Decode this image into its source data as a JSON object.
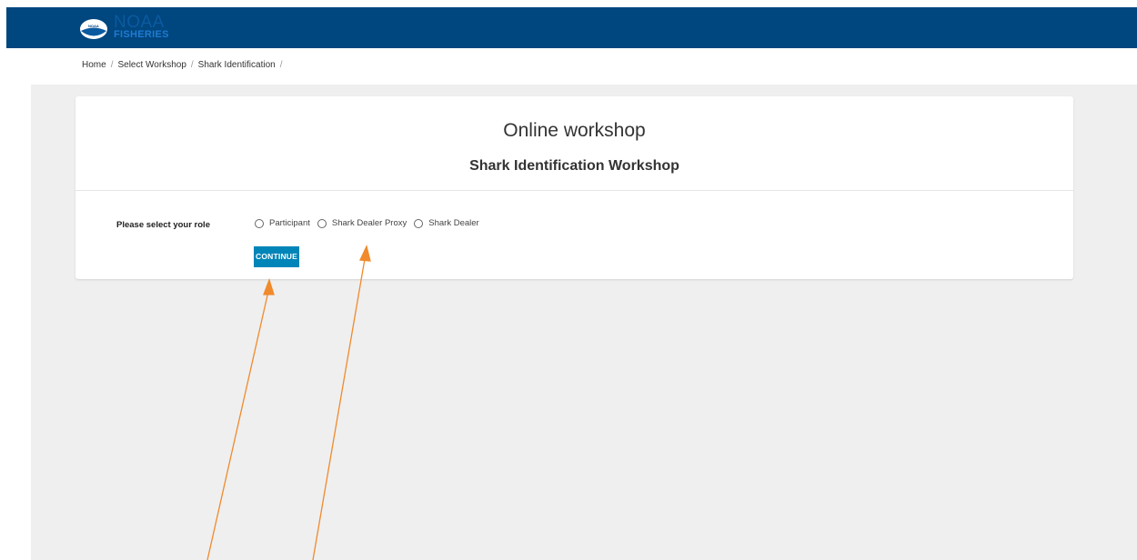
{
  "header": {
    "logo_text": "NOAA",
    "logo_subtext": "FISHERIES",
    "logo_badge_text": "NOAA"
  },
  "breadcrumb": {
    "items": [
      "Home",
      "Select Workshop",
      "Shark Identification"
    ],
    "separator": "/"
  },
  "card": {
    "title": "Online workshop",
    "subtitle": "Shark Identification Workshop"
  },
  "role_select": {
    "label": "Please select your role",
    "options": [
      "Participant",
      "Shark Dealer Proxy",
      "Shark Dealer"
    ]
  },
  "continue_button": {
    "label": "CONTINUE"
  },
  "colors": {
    "header_bg": "#00467f",
    "button_bg": "#0085b8",
    "annotation_arrow": "#f08a2c",
    "content_bg": "#efefef"
  }
}
